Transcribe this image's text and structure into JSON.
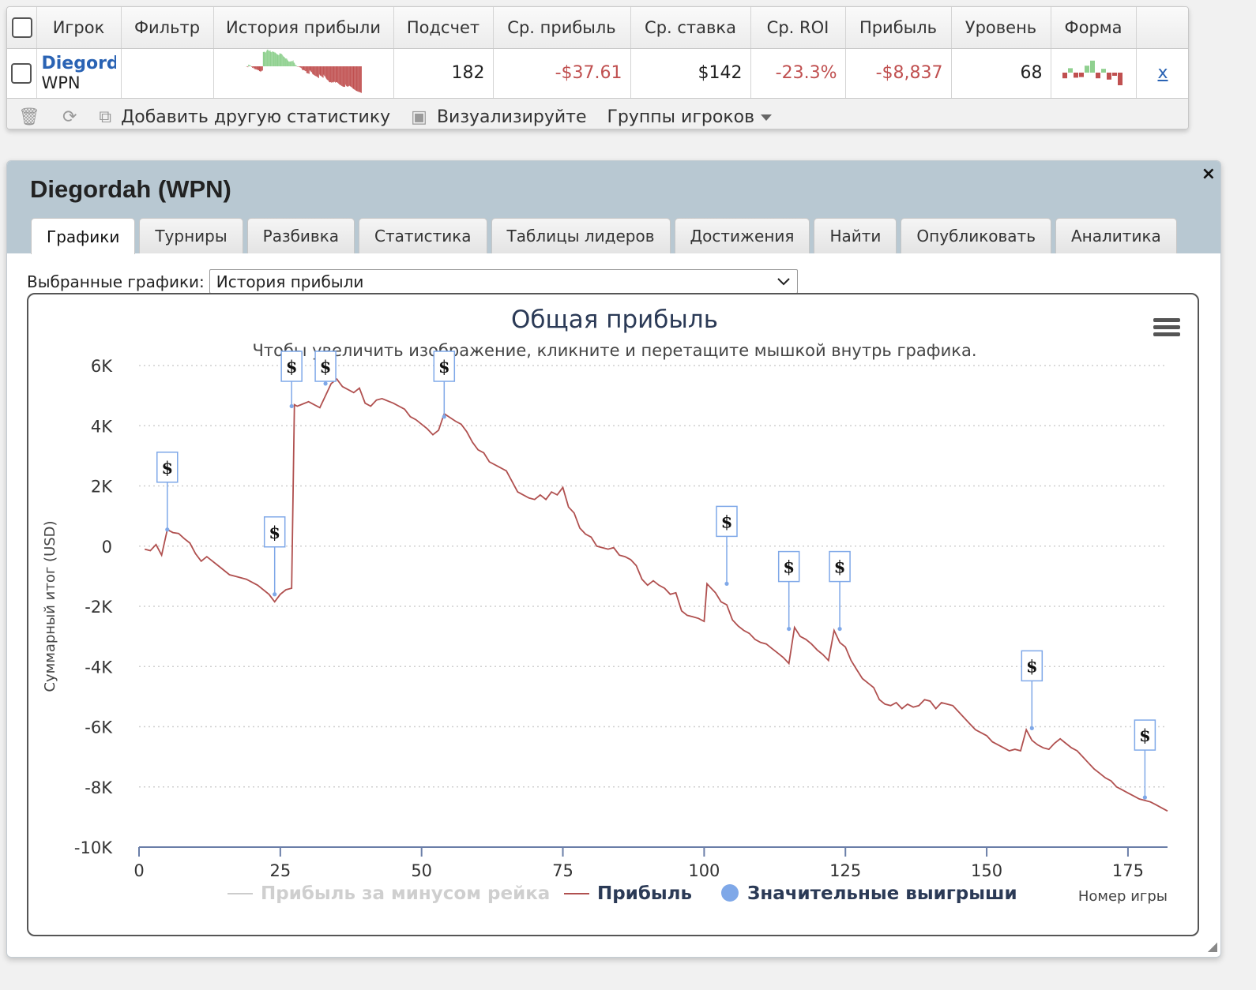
{
  "stats": {
    "columns": [
      "Игрок",
      "Фильтр",
      "История прибыли",
      "Подсчет",
      "Ср. прибыль",
      "Ср. ставка",
      "Ср. ROI",
      "Прибыль",
      "Уровень",
      "Форма"
    ],
    "row": {
      "player_name": "Diegordah",
      "site": "WPN",
      "filter": "",
      "count": "182",
      "avg_profit": "-$37.61",
      "avg_stake": "$142",
      "avg_roi": "-23.3%",
      "profit": "-$8,837",
      "level": "68",
      "remove": "x"
    },
    "toolbar": {
      "add_stat": "Добавить другую статистику",
      "visualize": "Визуализируйте",
      "player_groups": "Группы игроков"
    },
    "form_bars": [
      -0.45,
      0.35,
      -0.4,
      -0.35,
      0.55,
      0.95,
      -0.45,
      0.3,
      -0.55,
      -0.25,
      -1.0
    ],
    "colors": {
      "negative": "#c05050",
      "positive": "#8fd08f",
      "link": "#2a63b4"
    }
  },
  "dialog": {
    "title": "Diegordah (WPN)",
    "close": "×",
    "tabs": [
      "Графики",
      "Турниры",
      "Разбивка",
      "Статистика",
      "Таблицы лидеров",
      "Достижения",
      "Найти",
      "Опубликовать",
      "Аналитика"
    ],
    "active_tab": "Графики",
    "select_label": "Выбранные графики:",
    "select_value": "История прибыли"
  },
  "chart_data": {
    "type": "line",
    "title": "Общая прибыль",
    "subtitle": "Чтобы увеличить изображение, кликните и перетащите мышкой внутрь графика.",
    "xlabel": "Номер игры",
    "ylabel": "Суммарный итог (USD)",
    "xlim": [
      0,
      182
    ],
    "ylim": [
      -10000,
      6000
    ],
    "x_ticks": [
      "0",
      "25",
      "50",
      "75",
      "100",
      "125",
      "150",
      "175"
    ],
    "y_ticks": [
      "6K",
      "4K",
      "2K",
      "0",
      "-2K",
      "-4K",
      "-6K",
      "-8K",
      "-10K"
    ],
    "grid": true,
    "legend_position": "bottom",
    "series": [
      {
        "name": "Прибыль за минусом рейка",
        "color": "#cccccc",
        "visible": false,
        "values": []
      },
      {
        "name": "Прибыль",
        "color": "#b0504f",
        "points": [
          [
            1,
            -100
          ],
          [
            2,
            -150
          ],
          [
            3,
            50
          ],
          [
            4,
            -300
          ],
          [
            5,
            550
          ],
          [
            6,
            450
          ],
          [
            7,
            420
          ],
          [
            8,
            250
          ],
          [
            9,
            100
          ],
          [
            10,
            -250
          ],
          [
            11,
            -500
          ],
          [
            12,
            -350
          ],
          [
            14,
            -650
          ],
          [
            16,
            -950
          ],
          [
            17,
            -1000
          ],
          [
            19,
            -1100
          ],
          [
            21,
            -1300
          ],
          [
            23,
            -1600
          ],
          [
            24,
            -1850
          ],
          [
            25,
            -1600
          ],
          [
            26,
            -1450
          ],
          [
            27,
            -1400
          ],
          [
            27.5,
            4700
          ],
          [
            28,
            4650
          ],
          [
            30,
            4800
          ],
          [
            32,
            4600
          ],
          [
            33,
            5000
          ],
          [
            34,
            5400
          ],
          [
            35,
            5550
          ],
          [
            36,
            5300
          ],
          [
            38,
            5100
          ],
          [
            39,
            5250
          ],
          [
            40,
            4750
          ],
          [
            41,
            4650
          ],
          [
            42,
            4850
          ],
          [
            43,
            4900
          ],
          [
            45,
            4750
          ],
          [
            47,
            4550
          ],
          [
            48,
            4300
          ],
          [
            49,
            4200
          ],
          [
            51,
            3900
          ],
          [
            52,
            3700
          ],
          [
            53,
            3850
          ],
          [
            54,
            4400
          ],
          [
            56,
            4150
          ],
          [
            57,
            4050
          ],
          [
            58,
            3800
          ],
          [
            59,
            3450
          ],
          [
            60,
            3200
          ],
          [
            61,
            3100
          ],
          [
            62,
            2800
          ],
          [
            64,
            2600
          ],
          [
            65,
            2500
          ],
          [
            66,
            2150
          ],
          [
            67,
            1800
          ],
          [
            69,
            1600
          ],
          [
            70,
            1550
          ],
          [
            71,
            1700
          ],
          [
            72,
            1550
          ],
          [
            73,
            1800
          ],
          [
            74,
            1700
          ],
          [
            75,
            1950
          ],
          [
            76,
            1300
          ],
          [
            77,
            1100
          ],
          [
            78,
            600
          ],
          [
            79,
            400
          ],
          [
            80,
            300
          ],
          [
            81,
            0
          ],
          [
            82,
            -50
          ],
          [
            83,
            -100
          ],
          [
            84,
            -50
          ],
          [
            85,
            -300
          ],
          [
            86,
            -350
          ],
          [
            87,
            -450
          ],
          [
            88,
            -650
          ],
          [
            89,
            -1100
          ],
          [
            90,
            -1300
          ],
          [
            91,
            -1150
          ],
          [
            92,
            -1300
          ],
          [
            93,
            -1400
          ],
          [
            94,
            -1600
          ],
          [
            95,
            -1550
          ],
          [
            96,
            -2150
          ],
          [
            97,
            -2300
          ],
          [
            98,
            -2350
          ],
          [
            99,
            -2400
          ],
          [
            100,
            -2500
          ],
          [
            100.5,
            -1250
          ],
          [
            101,
            -1350
          ],
          [
            102,
            -1550
          ],
          [
            103,
            -1850
          ],
          [
            104,
            -1950
          ],
          [
            105,
            -2450
          ],
          [
            106,
            -2650
          ],
          [
            107,
            -2800
          ],
          [
            108,
            -2900
          ],
          [
            109,
            -3100
          ],
          [
            110,
            -3200
          ],
          [
            111,
            -3250
          ],
          [
            112,
            -3400
          ],
          [
            113,
            -3550
          ],
          [
            114,
            -3700
          ],
          [
            115,
            -3900
          ],
          [
            116,
            -2700
          ],
          [
            117,
            -3000
          ],
          [
            118,
            -3100
          ],
          [
            119,
            -3250
          ],
          [
            120,
            -3450
          ],
          [
            121,
            -3600
          ],
          [
            122,
            -3800
          ],
          [
            123,
            -2800
          ],
          [
            124,
            -3200
          ],
          [
            125,
            -3350
          ],
          [
            126,
            -3800
          ],
          [
            127,
            -4100
          ],
          [
            128,
            -4400
          ],
          [
            129,
            -4550
          ],
          [
            130,
            -4700
          ],
          [
            131,
            -5100
          ],
          [
            132,
            -5250
          ],
          [
            133,
            -5300
          ],
          [
            134,
            -5200
          ],
          [
            135,
            -5400
          ],
          [
            136,
            -5250
          ],
          [
            137,
            -5350
          ],
          [
            138,
            -5300
          ],
          [
            139,
            -5100
          ],
          [
            140,
            -5150
          ],
          [
            141,
            -5400
          ],
          [
            142,
            -5200
          ],
          [
            143,
            -5250
          ],
          [
            144,
            -5300
          ],
          [
            145,
            -5500
          ],
          [
            146,
            -5700
          ],
          [
            147,
            -5900
          ],
          [
            148,
            -6100
          ],
          [
            149,
            -6200
          ],
          [
            150,
            -6300
          ],
          [
            151,
            -6500
          ],
          [
            152,
            -6600
          ],
          [
            153,
            -6700
          ],
          [
            154,
            -6800
          ],
          [
            155,
            -6750
          ],
          [
            156,
            -6800
          ],
          [
            157,
            -6100
          ],
          [
            158,
            -6450
          ],
          [
            159,
            -6600
          ],
          [
            160,
            -6700
          ],
          [
            161,
            -6750
          ],
          [
            162,
            -6550
          ],
          [
            163,
            -6400
          ],
          [
            164,
            -6550
          ],
          [
            165,
            -6700
          ],
          [
            166,
            -6800
          ],
          [
            167,
            -7000
          ],
          [
            168,
            -7200
          ],
          [
            169,
            -7400
          ],
          [
            170,
            -7550
          ],
          [
            171,
            -7700
          ],
          [
            172,
            -7800
          ],
          [
            173,
            -8000
          ],
          [
            174,
            -8100
          ],
          [
            175,
            -8200
          ],
          [
            176,
            -8300
          ],
          [
            177,
            -8400
          ],
          [
            178,
            -8450
          ],
          [
            179,
            -8500
          ],
          [
            180,
            -8600
          ],
          [
            181,
            -8700
          ],
          [
            182,
            -8800
          ]
        ]
      },
      {
        "name": "Значительные выигрыши",
        "color": "#7fa8e8",
        "marker": "$",
        "points": [
          [
            5,
            550
          ],
          [
            24,
            -1600
          ],
          [
            27,
            4650
          ],
          [
            33,
            5400
          ],
          [
            54,
            4300
          ],
          [
            104,
            -1250
          ],
          [
            115,
            -2750
          ],
          [
            124,
            -2750
          ],
          [
            158,
            -6050
          ],
          [
            178,
            -8350
          ]
        ]
      }
    ]
  }
}
